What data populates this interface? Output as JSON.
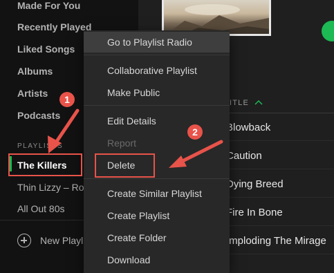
{
  "sidebar": {
    "nav": [
      "Made For You",
      "Recently Played",
      "Liked Songs",
      "Albums",
      "Artists",
      "Podcasts"
    ],
    "playlists_header": "PLAYLISTS",
    "playlists": [
      "The Killers",
      "Thin Lizzy – Ro",
      "All Out 80s"
    ],
    "new_playlist": "New Playl"
  },
  "main": {
    "title_header": "ITLE",
    "tracks": [
      "Blowback",
      "Caution",
      "Dying Breed",
      "Fire In Bone",
      "Imploding The Mirage"
    ]
  },
  "context_menu": {
    "items": [
      {
        "label": "Go to Playlist Radio",
        "state": "highlighted"
      },
      {
        "label": "Collaborative Playlist",
        "state": "normal"
      },
      {
        "label": "Make Public",
        "state": "normal"
      },
      {
        "label": "Edit Details",
        "state": "normal"
      },
      {
        "label": "Report",
        "state": "disabled"
      },
      {
        "label": "Delete",
        "state": "normal"
      },
      {
        "label": "Create Similar Playlist",
        "state": "normal"
      },
      {
        "label": "Create Playlist",
        "state": "normal"
      },
      {
        "label": "Create Folder",
        "state": "normal"
      },
      {
        "label": "Download",
        "state": "normal"
      }
    ]
  },
  "annotations": {
    "badge_1": "1",
    "badge_2": "2",
    "color": "#e8534a"
  },
  "colors": {
    "accent": "#1db954",
    "sidebar_bg": "#121212",
    "menu_bg": "#282828"
  },
  "icons": [
    "plus-circle-icon",
    "sort-ascending-icon"
  ]
}
